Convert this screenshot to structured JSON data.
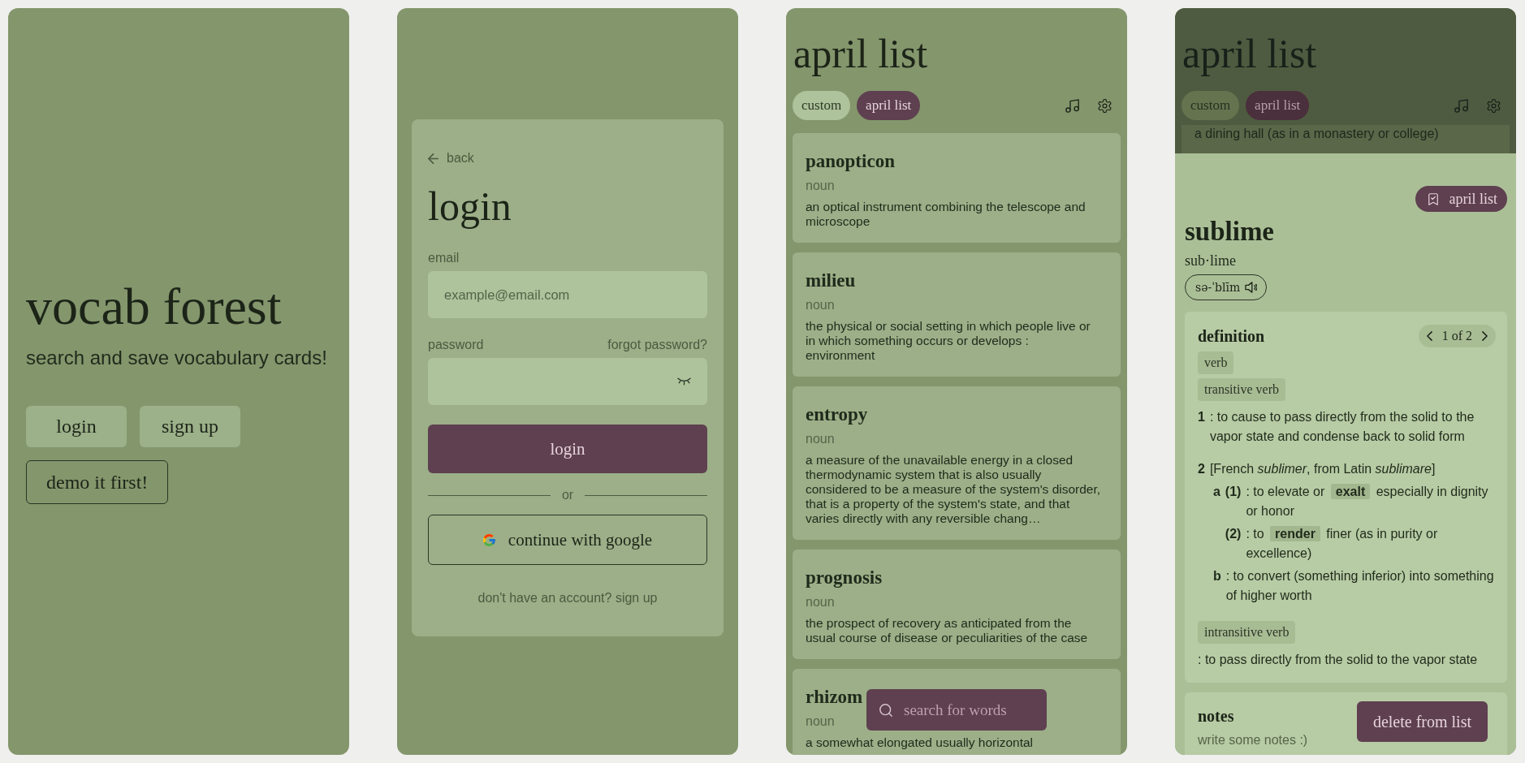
{
  "welcome": {
    "title": "vocab forest",
    "tagline": "search and save vocabulary cards!",
    "buttons": [
      {
        "label": "login",
        "kind": "filled"
      },
      {
        "label": "sign up",
        "kind": "filled"
      },
      {
        "label": "demo it first!",
        "kind": "outlined"
      }
    ]
  },
  "login": {
    "back": "back",
    "title": "login",
    "fields": [
      {
        "label": "email",
        "placeholder": "example@email.com",
        "kind": "email"
      },
      {
        "label": "password",
        "link": "forgot password?",
        "kind": "password"
      }
    ],
    "submit": "login",
    "divider": "or",
    "google": "continue with google",
    "signup_prompt": "don't have an account? sign up"
  },
  "list": {
    "title": "april list",
    "tabs": [
      {
        "label": "custom",
        "selected": false
      },
      {
        "label": "april list",
        "selected": true
      }
    ],
    "cards": [
      {
        "word": "panopticon",
        "pos": "noun",
        "definition": "an optical instrument combining the telescope and microscope"
      },
      {
        "word": "milieu",
        "pos": "noun",
        "definition": "the physical or social setting in which people live or in which something occurs or develops : environment"
      },
      {
        "word": "entropy",
        "pos": "noun",
        "definition": "a measure of the unavailable energy in a closed thermodynamic system that is also usually considered to be a measure of the system's disorder, that is a property of the system's state, and that varies directly with any reversible chang…"
      },
      {
        "word": "prognosis",
        "pos": "noun",
        "definition": "the prospect of recovery as anticipated from the usual course of disease or peculiarities of the case"
      },
      {
        "word": "rhizom",
        "pos": "noun",
        "definition": "a somewhat elongated usually horizontal"
      }
    ],
    "search": {
      "placeholder": "search for words"
    }
  },
  "word": {
    "backdrop": {
      "title": "april list",
      "tabs": [
        {
          "label": "custom",
          "selected": false
        },
        {
          "label": "april list",
          "selected": true
        }
      ],
      "card_text": "a dining hall (as in a monastery or college)"
    },
    "list_chip": "april list",
    "word": "sublime",
    "syllables": "sub·lime",
    "pronunciation": "sə-ˈblīm",
    "definition": {
      "heading": "definition",
      "pager": "1 of 2",
      "pos": "verb",
      "groups": [
        {
          "label": "transitive verb",
          "senses": [
            {
              "mark": "1",
              "text": [
                {
                  "t": ": to cause to pass directly from the solid to the vapor state and condense back to solid form",
                  "kind": "plain"
                }
              ]
            },
            {
              "mark": "2",
              "text": [
                {
                  "t": "[French *sublimer*, from Latin *sublimare*]",
                  "kind": "plain"
                }
              ],
              "children": [
                {
                  "mark": "a",
                  "children": [
                    {
                      "mark": "(1)",
                      "text": [
                        {
                          "t": ": to elevate or ",
                          "kind": "plain"
                        },
                        {
                          "t": "exalt",
                          "kind": "link"
                        },
                        {
                          "t": " especially in dignity or honor",
                          "kind": "plain"
                        }
                      ]
                    },
                    {
                      "mark": "(2)",
                      "text": [
                        {
                          "t": ": to ",
                          "kind": "plain"
                        },
                        {
                          "t": "render",
                          "kind": "link"
                        },
                        {
                          "t": " finer (as in purity or excellence)",
                          "kind": "plain"
                        }
                      ]
                    }
                  ]
                },
                {
                  "mark": "b",
                  "text": [
                    {
                      "t": ": to convert (something inferior) into something of higher worth",
                      "kind": "plain"
                    }
                  ]
                }
              ]
            }
          ]
        },
        {
          "label": "intransitive verb",
          "senses": [
            {
              "text": [
                {
                  "t": ": to pass directly from the solid to the vapor state",
                  "kind": "plain"
                }
              ]
            }
          ]
        }
      ]
    },
    "notes": {
      "heading": "notes",
      "placeholder": "write some notes :)"
    },
    "delete": "delete from list"
  }
}
